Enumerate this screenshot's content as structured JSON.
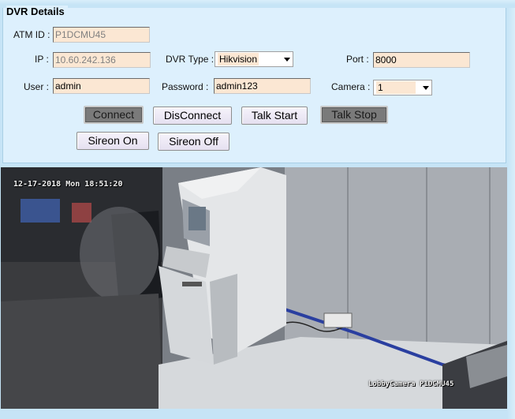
{
  "panel": {
    "title": "DVR Details"
  },
  "fields": {
    "atm_id_label": "ATM ID :",
    "atm_id_value": "P1DCMU45",
    "ip_label": "IP :",
    "ip_value": "10.60.242.136",
    "dvr_type_label": "DVR Type :",
    "dvr_type_value": "Hikvision",
    "port_label": "Port :",
    "port_value": "8000",
    "user_label": "User :",
    "user_value": "admin",
    "password_label": "Password :",
    "password_value": "admin123",
    "camera_label": "Camera :",
    "camera_value": "1"
  },
  "buttons": {
    "connect": "Connect",
    "disconnect": "DisConnect",
    "talk_start": "Talk Start",
    "talk_stop": "Talk Stop",
    "sireon_on": "Sireon On",
    "sireon_off": "Sireon Off"
  },
  "video": {
    "timestamp": "12-17-2018 Mon 18:51:20",
    "camera_name": "LobbyCamera P1DCMU45"
  },
  "colors": {
    "background": "#c6e4f6",
    "panel": "#ddf0fd",
    "input_fill": "#fbe7d3",
    "disabled_button": "#7a7a7a"
  }
}
